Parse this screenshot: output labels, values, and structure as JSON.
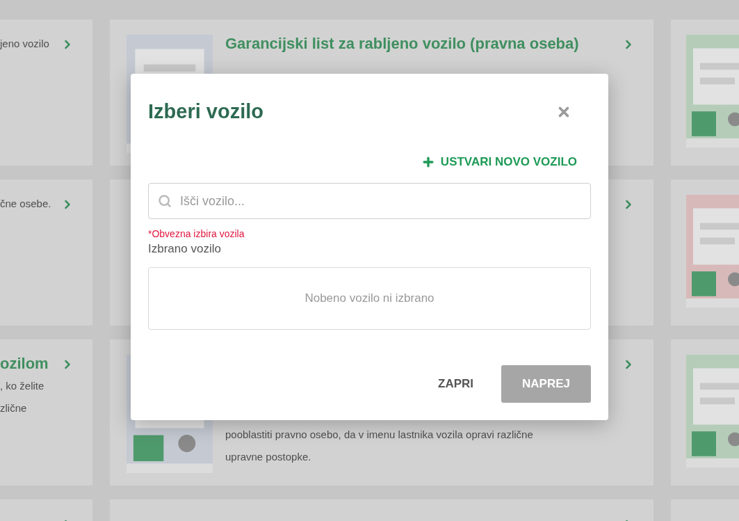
{
  "background": {
    "rows": [
      {
        "left": {
          "lines": [
            "jeno vozilo"
          ]
        },
        "middle": {
          "title": "Garancijski list za rabljeno vozilo (pravna oseba)",
          "picture": true
        },
        "right": {
          "picture": true
        }
      },
      {
        "left": {
          "lines": [
            "čne osebe."
          ]
        },
        "middle": {
          "picture": false
        },
        "right": {
          "picture": true
        }
      },
      {
        "left": {
          "title": "ozilom",
          "lines": [
            ", ko želite",
            "zlične"
          ]
        },
        "middle": {
          "lines": [
            "pooblastiti pravno osebo, da v imenu lastnika vozila opravi različne",
            "upravne postopke."
          ],
          "picture": true
        },
        "right": {
          "picture": true
        }
      },
      {
        "left": {},
        "middle": {
          "picture": false
        },
        "right": {
          "picture": false
        }
      }
    ]
  },
  "dialog": {
    "title": "Izberi vozilo",
    "create_label": "USTVARI NOVO VOZILO",
    "search": {
      "placeholder": "Išči vozilo..."
    },
    "error": "*Obvezna izbira vozila",
    "selected_label": "Izbrano vozilo",
    "selected_empty": "Nobeno vozilo ni izbrano",
    "buttons": [
      {
        "kind": "text",
        "label": "ZAPRI",
        "disabled": false
      },
      {
        "kind": "primary",
        "label": "NAPREJ",
        "disabled": true
      }
    ]
  }
}
